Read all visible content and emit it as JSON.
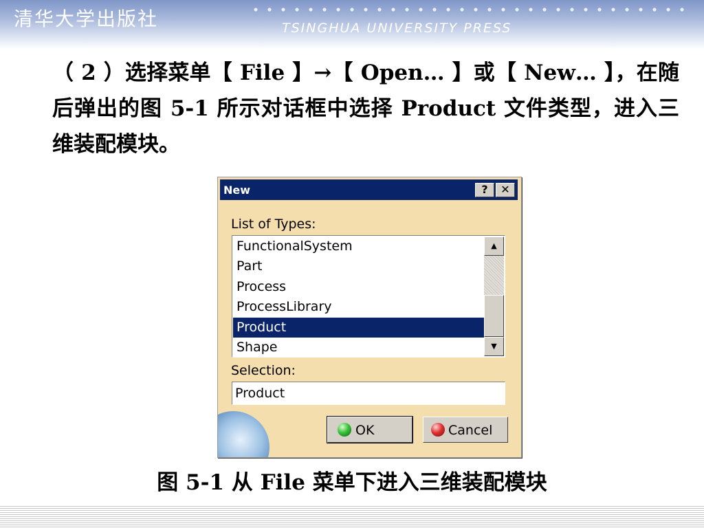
{
  "header": {
    "publisher_cn": "清华大学出版社",
    "publisher_en": "TSINGHUA UNIVERSITY PRESS"
  },
  "body": {
    "paragraph": "（ 2 ）选择菜单【 File 】→【 Open… 】或【 New… 】，在随后弹出的图 5-1 所示对话框中选择 Product 文件类型，进入三维装配模块。"
  },
  "dialog": {
    "title": "New",
    "help_label": "?",
    "close_label": "✕",
    "list_label": "List of Types:",
    "types": [
      "FunctionalSystem",
      "Part",
      "Process",
      "ProcessLibrary",
      "Product",
      "Shape"
    ],
    "selected_index": 4,
    "selection_label": "Selection:",
    "selection_value": "Product",
    "ok_label": "OK",
    "cancel_label": "Cancel",
    "scroll_up_icon": "▲",
    "scroll_down_icon": "▼"
  },
  "caption": "图  5-1  从 File 菜单下进入三维装配模块",
  "colors": {
    "dialog_bg": "#f5deae",
    "titlebar": "#0a246a",
    "selection_highlight": "#0a246a",
    "header_blue": "#7f96c8"
  }
}
